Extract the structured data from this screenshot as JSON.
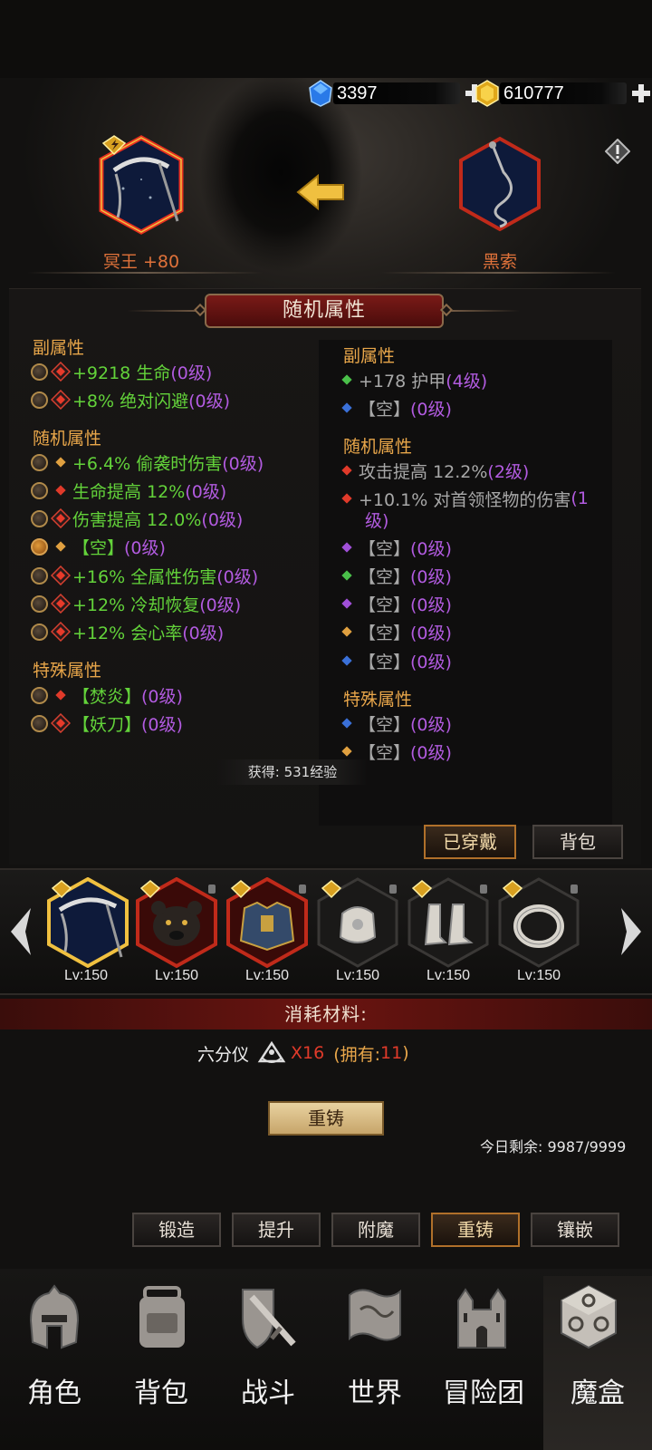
{
  "currency": {
    "gems": "3397",
    "gold": "610777"
  },
  "compare": {
    "left_item_name": "冥王 +80",
    "right_item_name": "黑索"
  },
  "panel": {
    "title": "随机属性",
    "left": {
      "sub_title": "副属性",
      "sub_rows": [
        {
          "stat": "+9218 生命",
          "level": "(0级)"
        },
        {
          "stat": "+8% 绝对闪避",
          "level": "(0级)"
        }
      ],
      "random_title": "随机属性",
      "random_rows": [
        {
          "stat": "+6.4% 偷袭时伤害",
          "level": "(0级)"
        },
        {
          "stat": "生命提高 12%",
          "level": "(0级)"
        },
        {
          "stat": "伤害提高 12.0%",
          "level": "(0级)"
        },
        {
          "stat": "【空】",
          "level": "(0级)"
        },
        {
          "stat": "+16% 全属性伤害",
          "level": "(0级)"
        },
        {
          "stat": "+12% 冷却恢复",
          "level": "(0级)"
        },
        {
          "stat": "+12% 会心率",
          "level": "(0级)"
        }
      ],
      "special_title": "特殊属性",
      "special_rows": [
        {
          "stat": "【焚炎】",
          "level": "(0级)"
        },
        {
          "stat": "【妖刀】",
          "level": "(0级)"
        }
      ]
    },
    "right": {
      "sub_title": "副属性",
      "sub_rows": [
        {
          "stat": "+178 护甲",
          "level": "(4级)"
        },
        {
          "stat": "【空】",
          "level": "(0级)"
        }
      ],
      "random_title": "随机属性",
      "random_rows": [
        {
          "stat": "攻击提高 12.2%",
          "level": "(2级)"
        },
        {
          "stat": "+10.1% 对首领怪物的伤害",
          "level": "(1",
          "level2": "级)"
        },
        {
          "stat": "【空】",
          "level": "(0级)"
        },
        {
          "stat": "【空】",
          "level": "(0级)"
        },
        {
          "stat": "【空】",
          "level": "(0级)"
        },
        {
          "stat": "【空】",
          "level": "(0级)"
        },
        {
          "stat": "【空】",
          "level": "(0级)"
        }
      ],
      "special_title": "特殊属性",
      "special_rows": [
        {
          "stat": "【空】",
          "level": "(0级)"
        },
        {
          "stat": "【空】",
          "level": "(0级)"
        }
      ]
    },
    "exp_text": "获得: 531经验",
    "equipped_btn": "已穿戴",
    "bag_btn": "背包"
  },
  "equip_slots": [
    {
      "icon": "scythe-icon",
      "level": "Lv:150"
    },
    {
      "icon": "bear-helmet-icon",
      "level": "Lv:150"
    },
    {
      "icon": "chest-armor-icon",
      "level": "Lv:150"
    },
    {
      "icon": "gauntlet-icon",
      "level": "Lv:150"
    },
    {
      "icon": "boots-icon",
      "level": "Lv:150"
    },
    {
      "icon": "ring-icon",
      "level": "Lv:150"
    }
  ],
  "consume": {
    "title": "消耗材料:",
    "material_name": "六分仪",
    "material_icon": "sextant-icon",
    "cost": "X16",
    "owned_prefix": "(拥有: ",
    "owned": "11",
    "owned_suffix": ")"
  },
  "reforge_button": "重铸",
  "remaining": "今日剩余: 9987/9999",
  "tabs": [
    "锻造",
    "提升",
    "附魔",
    "重铸",
    "镶嵌"
  ],
  "active_tab": "重铸",
  "bottom_nav": [
    {
      "label": "角色",
      "icon": "helmet-icon"
    },
    {
      "label": "背包",
      "icon": "backpack-icon"
    },
    {
      "label": "战斗",
      "icon": "sword-shield-icon"
    },
    {
      "label": "世界",
      "icon": "map-scroll-icon"
    },
    {
      "label": "冒险团",
      "icon": "castle-icon"
    },
    {
      "label": "魔盒",
      "icon": "magic-cube-icon"
    }
  ],
  "active_nav": "魔盒",
  "colors": {
    "stat_green": "#63d33a",
    "level_purple": "#b25be0",
    "section_orange": "#e8a64a",
    "item_name_orange": "#e0723a",
    "cost_red": "#e03a2a"
  }
}
